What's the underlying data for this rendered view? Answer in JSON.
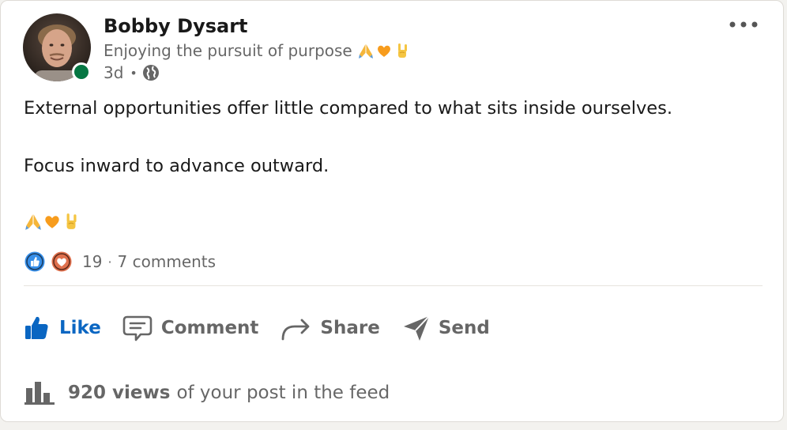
{
  "author": {
    "name": "Bobby Dysart",
    "headline": "Enjoying the pursuit of purpose",
    "headline_emojis": [
      "folded-hands",
      "orange-heart",
      "sign-of-horns"
    ],
    "time_ago": "3d",
    "meta_separator": "•",
    "visibility_icon": "globe-icon",
    "online": true
  },
  "post": {
    "line1": "External opportunities offer little compared to what sits inside ourselves.",
    "line2": "Focus inward to advance outward.",
    "emojis": [
      "folded-hands",
      "orange-heart",
      "sign-of-horns"
    ]
  },
  "social": {
    "reaction_icons": [
      "like-reaction-icon",
      "love-reaction-icon"
    ],
    "reaction_count": "19",
    "separator": "·",
    "comments": "7 comments"
  },
  "actions": {
    "like": "Like",
    "comment": "Comment",
    "share": "Share",
    "send": "Send"
  },
  "analytics": {
    "views_count": "920 views",
    "views_suffix": "of your post in the feed"
  },
  "colors": {
    "accent": "#0a66c2",
    "online": "#057642",
    "like_reaction": "#378fe9",
    "love_reaction": "#df704d",
    "heart_emoji": "#f79c1d"
  }
}
